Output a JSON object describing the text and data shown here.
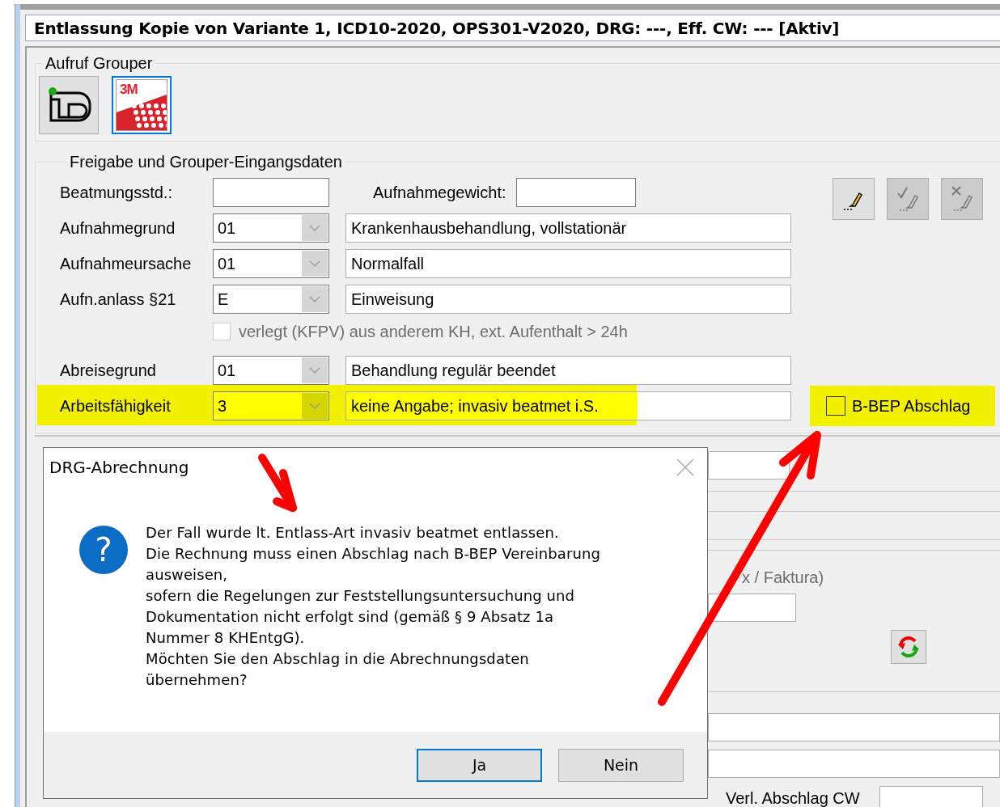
{
  "window": {
    "title": "Entlassung Kopie von Variante 1, ICD10-2020, OPS301-V2020, DRG: ---, Eff. CW: --- [Aktiv]"
  },
  "grouper": {
    "label": "Aufruf Grouper",
    "buttons": [
      {
        "kind": "id",
        "selected": false
      },
      {
        "kind": "logo",
        "logo_text": "3M",
        "selected": true
      }
    ]
  },
  "input_data": {
    "label": "Freigabe und Grouper-Eingangsdaten",
    "ventilation_hours": {
      "label": "Beatmungsstd.:"
    },
    "admission_weight": {
      "label": "Aufnahmegewicht:"
    },
    "rows": [
      {
        "kind": "combo",
        "label": "Aufnahmegrund",
        "code": "01",
        "description": "Krankenhausbehandlung, vollstationär",
        "highlighted": false
      },
      {
        "kind": "combo",
        "label": "Aufnahmeursache",
        "code": "01",
        "description": "Normalfall",
        "highlighted": false
      },
      {
        "kind": "combo",
        "label": "Aufn.anlass §21",
        "code": "E",
        "description": "Einweisung",
        "highlighted": false
      },
      {
        "kind": "checkbox",
        "label": "verlegt (KFPV) aus anderem KH, ext. Aufenthalt > 24h",
        "checked": false,
        "disabled": true
      },
      {
        "kind": "combo",
        "label": "Abreisegrund",
        "code": "01",
        "description": "Behandlung regulär beendet",
        "highlighted": false
      },
      {
        "kind": "combo",
        "label": "Arbeitsfähigkeit",
        "code": "3",
        "description": "keine Angabe; invasiv beatmet i.S.",
        "highlighted": true
      }
    ],
    "edit_buttons": [
      {
        "kind": "edit",
        "disabled": false
      },
      {
        "kind": "confirm",
        "disabled": true
      },
      {
        "kind": "cancel",
        "disabled": true
      }
    ],
    "bbep": {
      "label": "B-BEP Abschlag",
      "checked": false,
      "highlighted": true
    }
  },
  "lower": {
    "faktura_label": "x / Faktura)",
    "verl_label": "Verl. Abschlag CW"
  },
  "dialog": {
    "title": "DRG-Abrechnung",
    "icon": "?",
    "lines": [
      "Der Fall wurde lt. Entlass-Art invasiv beatmet entlassen.",
      "Die Rechnung muss einen Abschlag nach B-BEP Vereinbarung",
      "ausweisen,",
      "sofern die Regelungen zur Feststellungsuntersuchung und",
      "Dokumentation nicht erfolgt sind (gemäß § 9 Absatz 1a",
      "Nummer 8 KHEntgG).",
      "Möchten Sie den Abschlag in die Abrechnungsdaten",
      "übernehmen?"
    ],
    "buttons": [
      {
        "label": "Ja",
        "selected": true
      },
      {
        "label": "Nein",
        "selected": false
      }
    ]
  }
}
